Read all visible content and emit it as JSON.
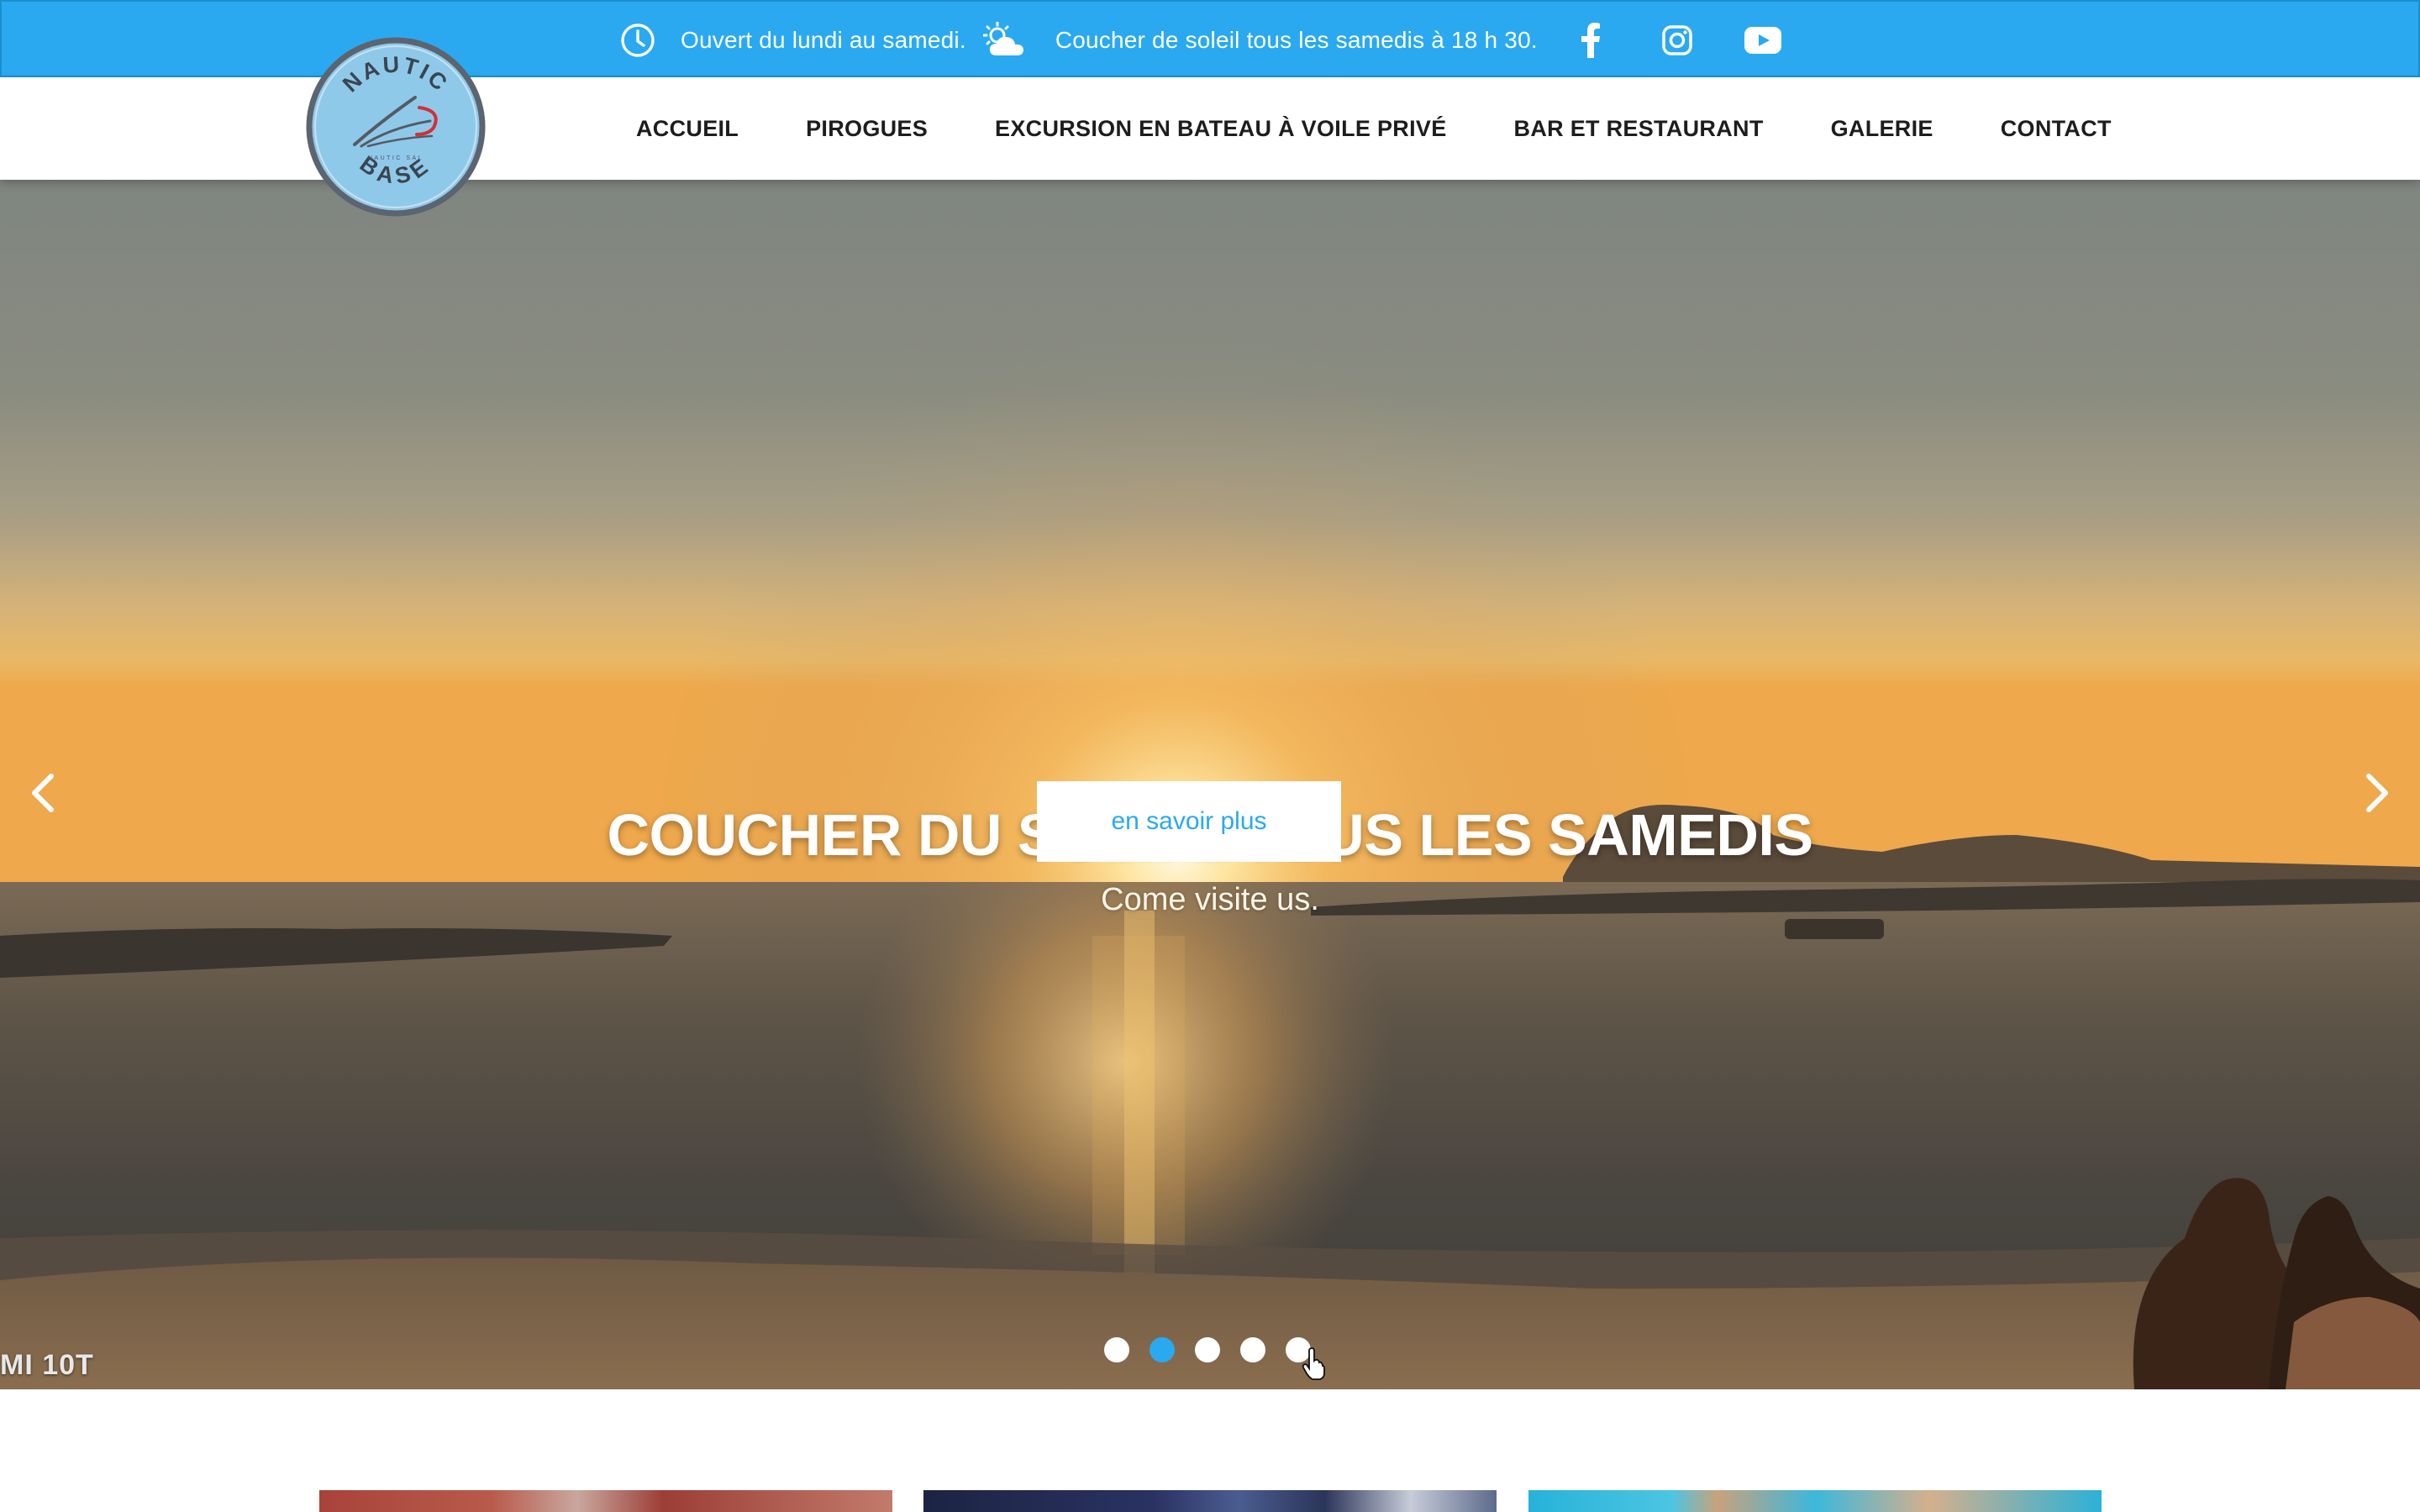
{
  "topbar": {
    "hours_text": "Ouvert du lundi au samedi.",
    "sunset_text": "Coucher de soleil tous les samedis à 18 h 30.",
    "icons": [
      "clock-icon",
      "sun-cloud-icon",
      "facebook-icon",
      "instagram-icon",
      "youtube-icon"
    ],
    "color": "#2aa9f0"
  },
  "logo": {
    "top_text": "NAUTIC",
    "bottom_text": "BASE",
    "small_text": "NAUTIC SAL"
  },
  "nav": {
    "items": [
      {
        "label": "ACCUEIL"
      },
      {
        "label": "PIROGUES"
      },
      {
        "label": "EXCURSION EN BATEAU À VOILE PRIVÉ"
      },
      {
        "label": "BAR ET RESTAURANT"
      },
      {
        "label": "GALERIE"
      },
      {
        "label": "CONTACT"
      }
    ]
  },
  "hero": {
    "title": "COUCHER DU SOLEIL TOUS LES SAMEDIS",
    "subtitle": "Come visite us.",
    "button_label": "en savoir plus",
    "watermark": "MI 10T",
    "slides_total": 5,
    "active_slide": 2,
    "accent": "#2aa9f0"
  }
}
